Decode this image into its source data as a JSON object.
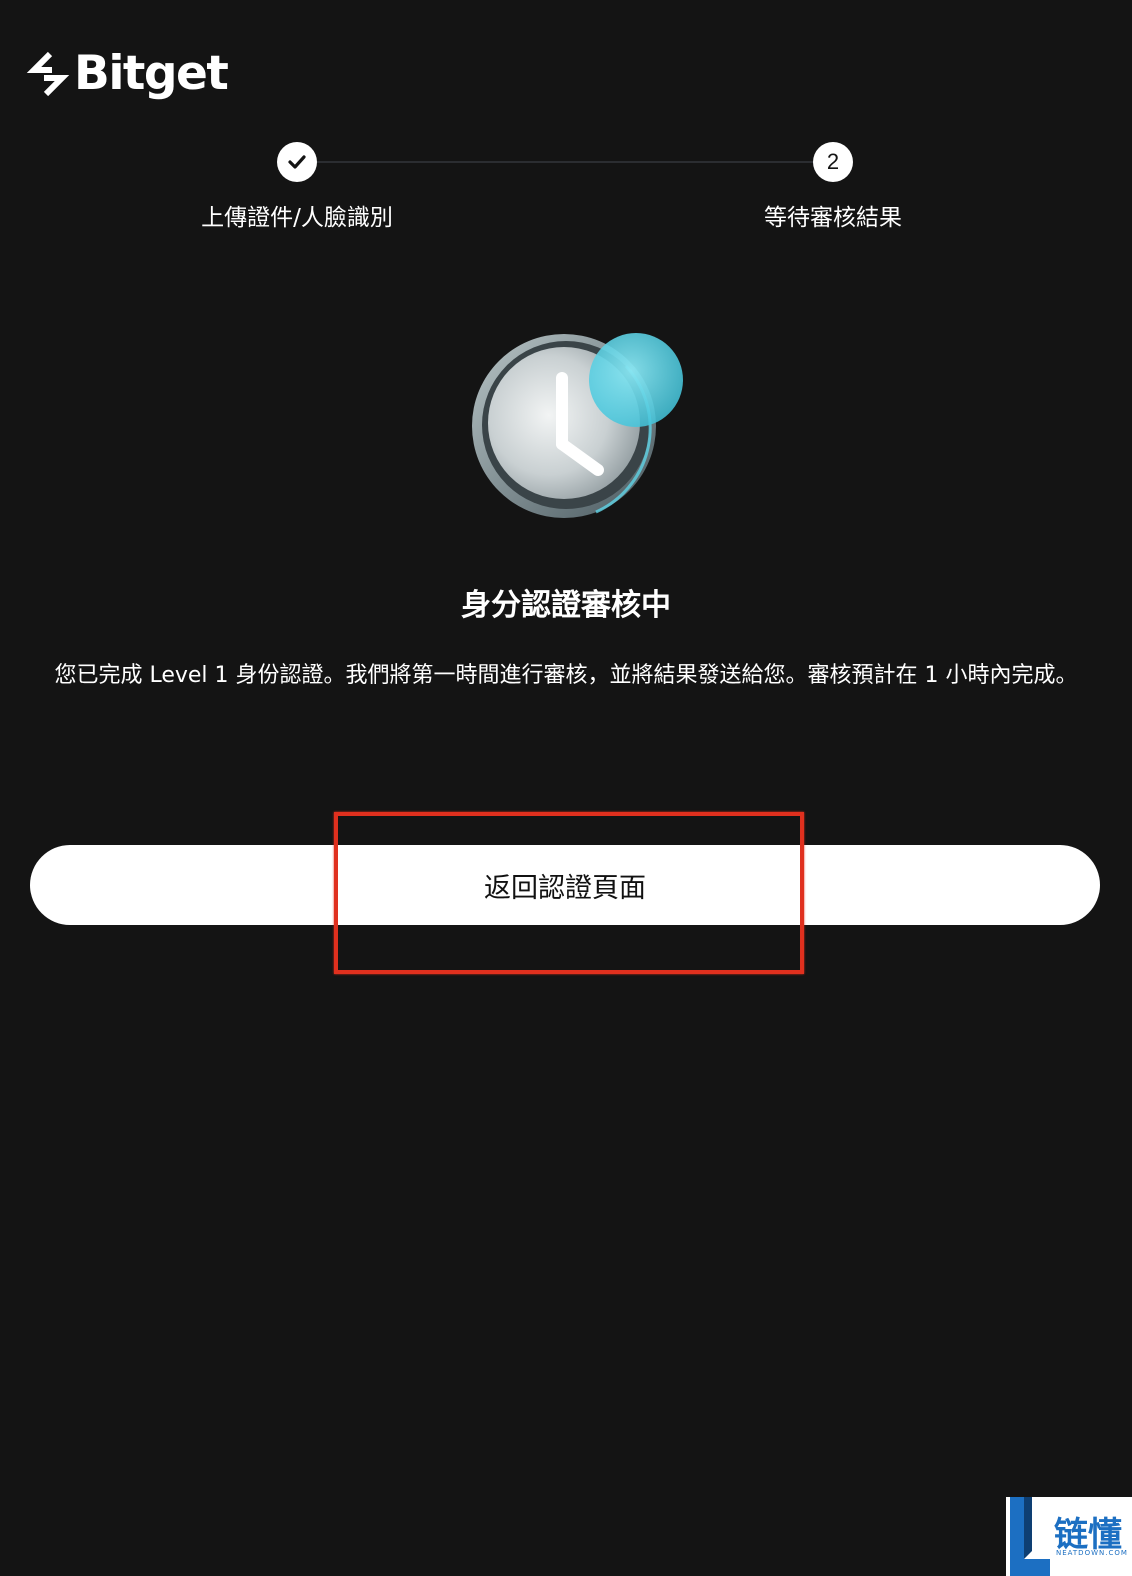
{
  "brand": {
    "name": "Bitget"
  },
  "stepper": {
    "steps": [
      {
        "label": "上傳證件/人臉識別",
        "status": "completed",
        "marker": ""
      },
      {
        "label": "等待審核結果",
        "status": "current",
        "marker": "2"
      }
    ]
  },
  "main": {
    "title": "身分認證審核中",
    "description": "您已完成 Level 1 身份認證。我們將第一時間進行審核，並將結果發送給您。審核預計在 1 小時內完成。",
    "back_button_label": "返回認證頁面"
  },
  "annotation": {
    "color": "#e0301e"
  },
  "watermark": {
    "text": "链懂",
    "sub": "NEATDOWN.COM",
    "color": "#1c6fc2"
  },
  "colors": {
    "background": "#141414",
    "button_bg": "#ffffff",
    "clock_accent": "#5fd3e6"
  }
}
